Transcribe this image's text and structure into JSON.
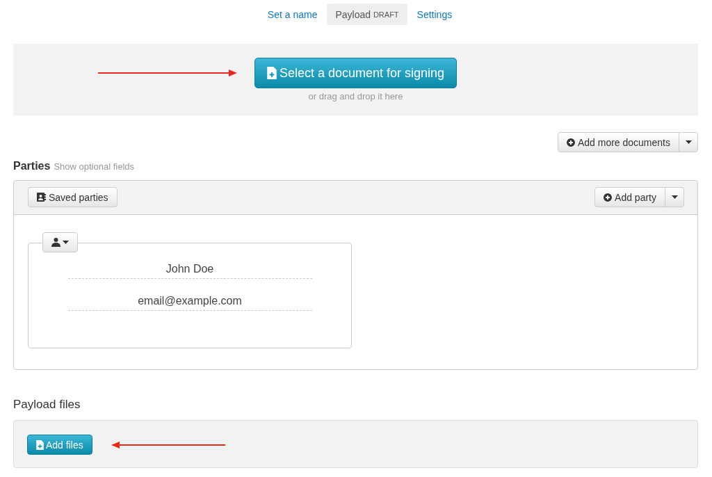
{
  "nav_tabs": [
    {
      "label": "Set a name",
      "selected": false
    },
    {
      "label": "Payload",
      "badge": "DRAFT",
      "selected": true
    },
    {
      "label": "Settings",
      "selected": false
    }
  ],
  "document_dropzone": {
    "button": "Select a document for signing",
    "hint": "or drag and drop it here",
    "callout_arrow": true
  },
  "add_documents_button": {
    "label": "Add more documents"
  },
  "parties": {
    "title": "Parties",
    "optional_fields_link": "Show optional fields",
    "saved_parties_button": "Saved parties",
    "add_party_button": "Add party",
    "party_cards": [
      {
        "name": "John Doe",
        "email": "email@example.com"
      }
    ]
  },
  "payload_files": {
    "title": "Payload files",
    "add_files_button": "Add files",
    "callout_arrow": true
  }
}
